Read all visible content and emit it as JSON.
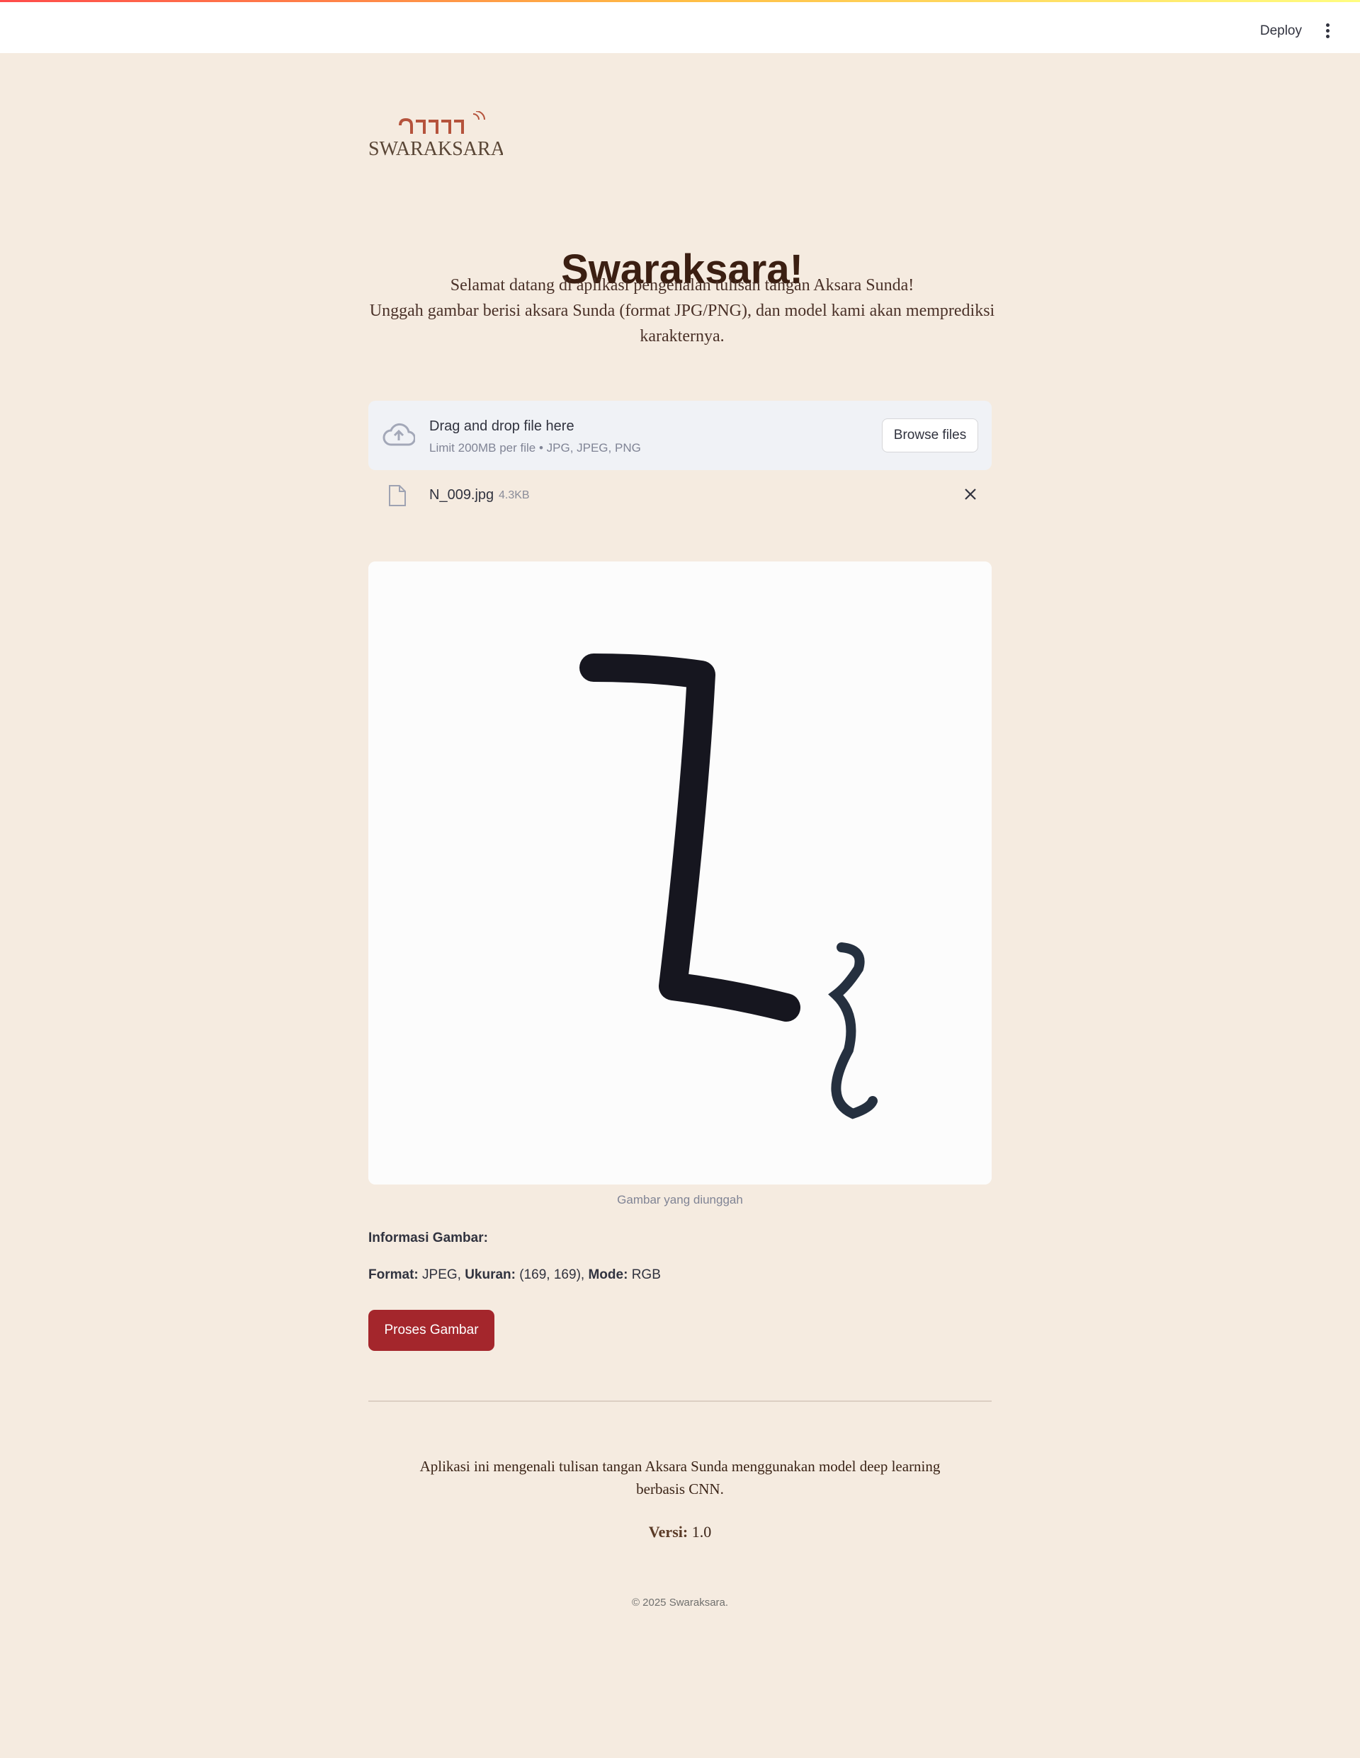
{
  "toolbar": {
    "deploy_label": "Deploy",
    "menu_icon": "more-vertical-icon"
  },
  "brand": {
    "logo_script": "ᮘᮥᮛᮊᮞᮛ",
    "logo_text": "SWARAKSARA",
    "logo_color": "#b5533c"
  },
  "header": {
    "title": "Swaraksara!",
    "intro_line1": "Selamat datang di aplikasi pengenalan tulisan tangan Aksara Sunda!",
    "intro_line2": "Unggah gambar berisi aksara Sunda (format JPG/PNG), dan model kami akan memprediksi karakternya."
  },
  "uploader": {
    "icon": "cloud-upload-icon",
    "title": "Drag and drop file here",
    "subtitle": "Limit 200MB per file • JPG, JPEG, PNG",
    "browse_label": "Browse files"
  },
  "uploaded_file": {
    "icon": "file-icon",
    "name": "N_009.jpg",
    "size": "4.3KB",
    "remove_icon": "close-icon"
  },
  "preview": {
    "caption": "Gambar yang diunggah"
  },
  "info": {
    "heading": "Informasi Gambar:",
    "format_label": "Format:",
    "format_value": "JPEG,",
    "size_label": "Ukuran:",
    "size_value": "(169, 169),",
    "mode_label": "Mode:",
    "mode_value": "RGB"
  },
  "actions": {
    "process_label": "Proses Gambar",
    "process_color": "#a4262c"
  },
  "footer": {
    "about": "Aplikasi ini mengenali tulisan tangan Aksara Sunda menggunakan model deep learning berbasis CNN.",
    "version_label": "Versi:",
    "version_value": "1.0",
    "copyright": "© 2025 Swaraksara."
  }
}
